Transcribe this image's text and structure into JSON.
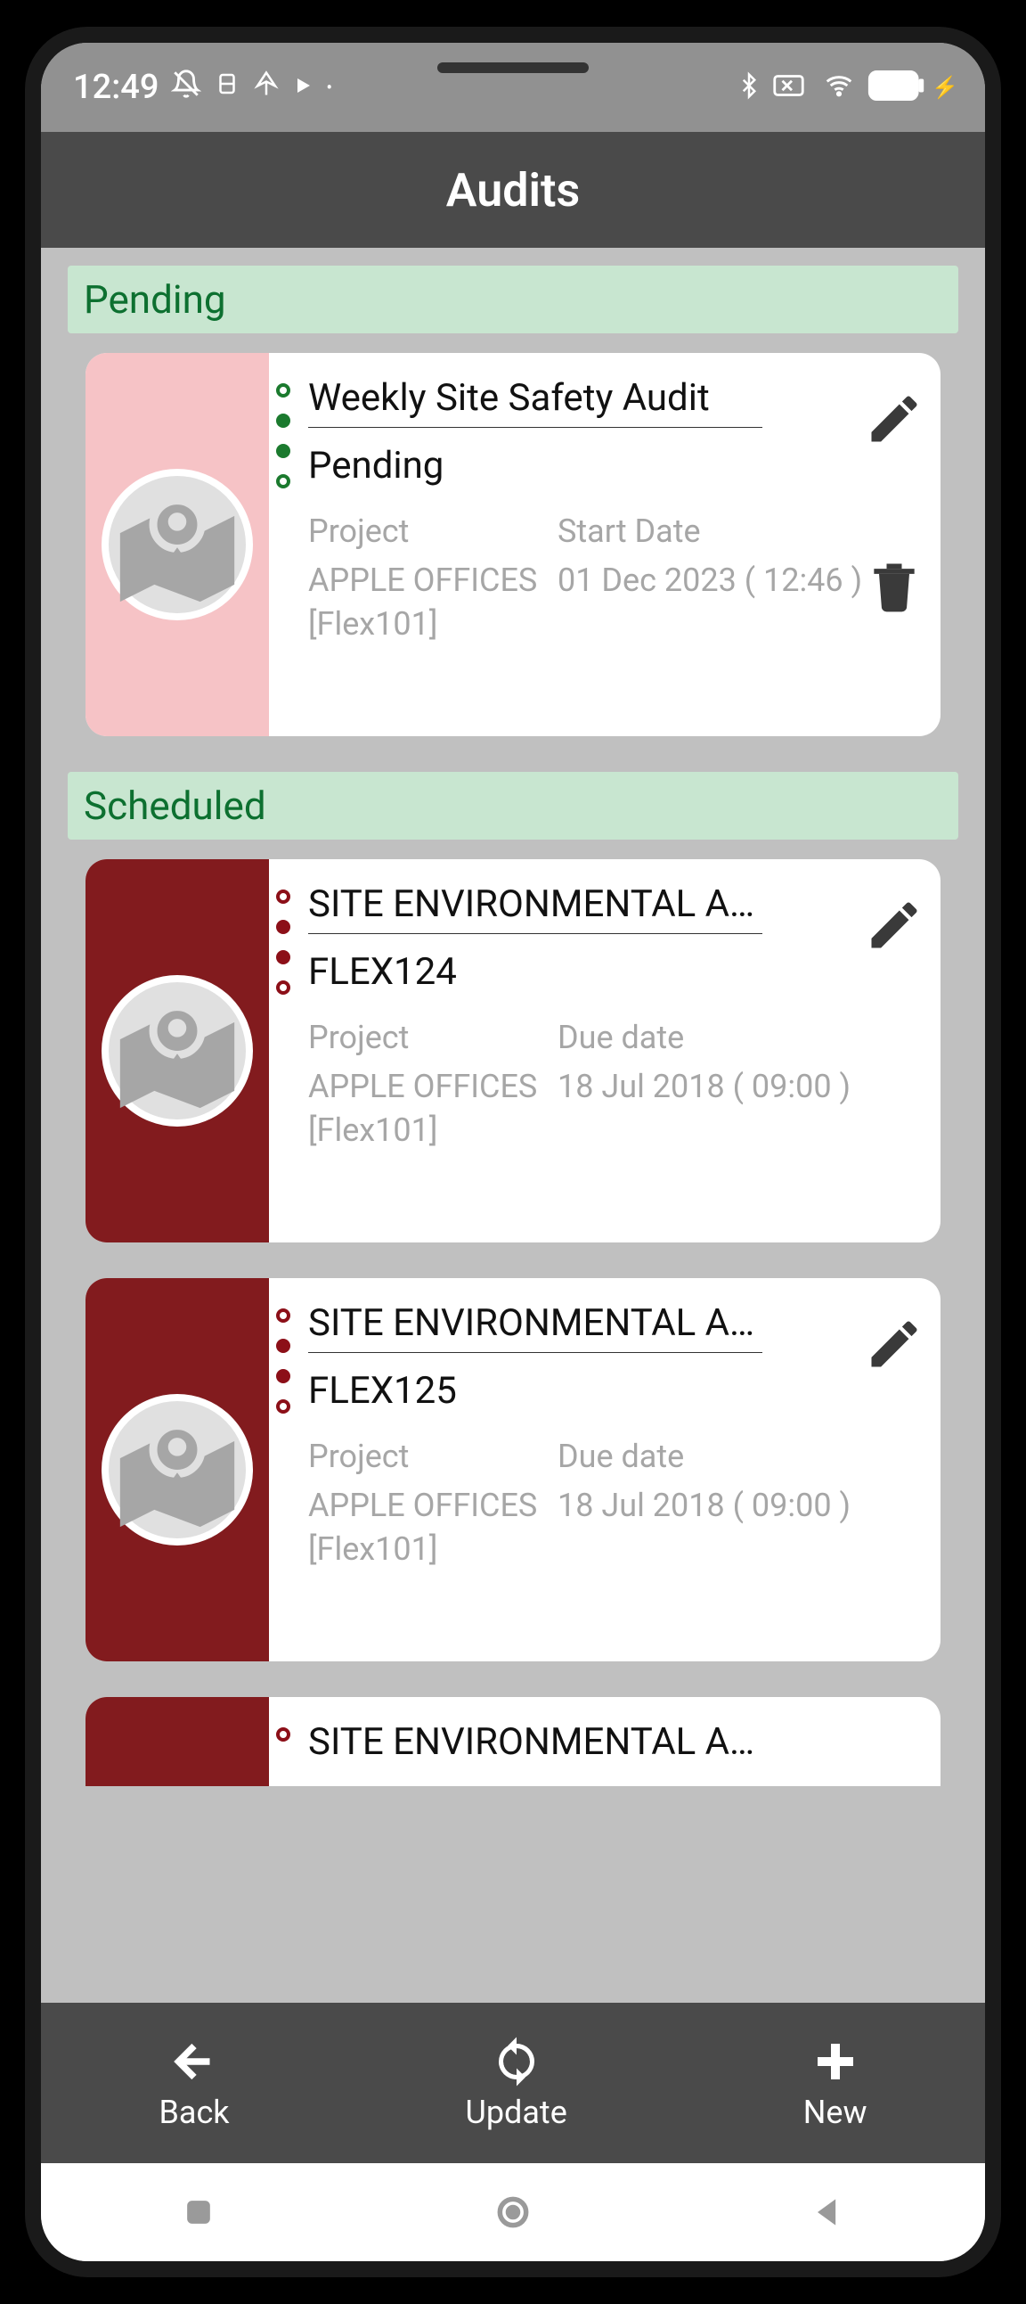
{
  "status": {
    "time": "12:49"
  },
  "header": {
    "title": "Audits"
  },
  "sections": {
    "pending": {
      "label": "Pending"
    },
    "scheduled": {
      "label": "Scheduled"
    }
  },
  "cards": [
    {
      "title": "Weekly Site Safety Audit",
      "subtitle": "Pending",
      "projectHeading": "Project",
      "project": "APPLE OFFICES [Flex101]",
      "dateHeading": "Start Date",
      "date": "01 Dec 2023 ( 12:46 )"
    },
    {
      "title": "SITE ENVIRONMENTAL A…",
      "subtitle": "FLEX124",
      "projectHeading": "Project",
      "project": "APPLE OFFICES [Flex101]",
      "dateHeading": "Due date",
      "date": "18 Jul 2018 ( 09:00 )"
    },
    {
      "title": "SITE ENVIRONMENTAL A…",
      "subtitle": "FLEX125",
      "projectHeading": "Project",
      "project": "APPLE OFFICES [Flex101]",
      "dateHeading": "Due date",
      "date": "18 Jul 2018 ( 09:00 )"
    },
    {
      "title": "SITE ENVIRONMENTAL A…"
    }
  ],
  "nav": {
    "back": "Back",
    "update": "Update",
    "new": "New"
  }
}
